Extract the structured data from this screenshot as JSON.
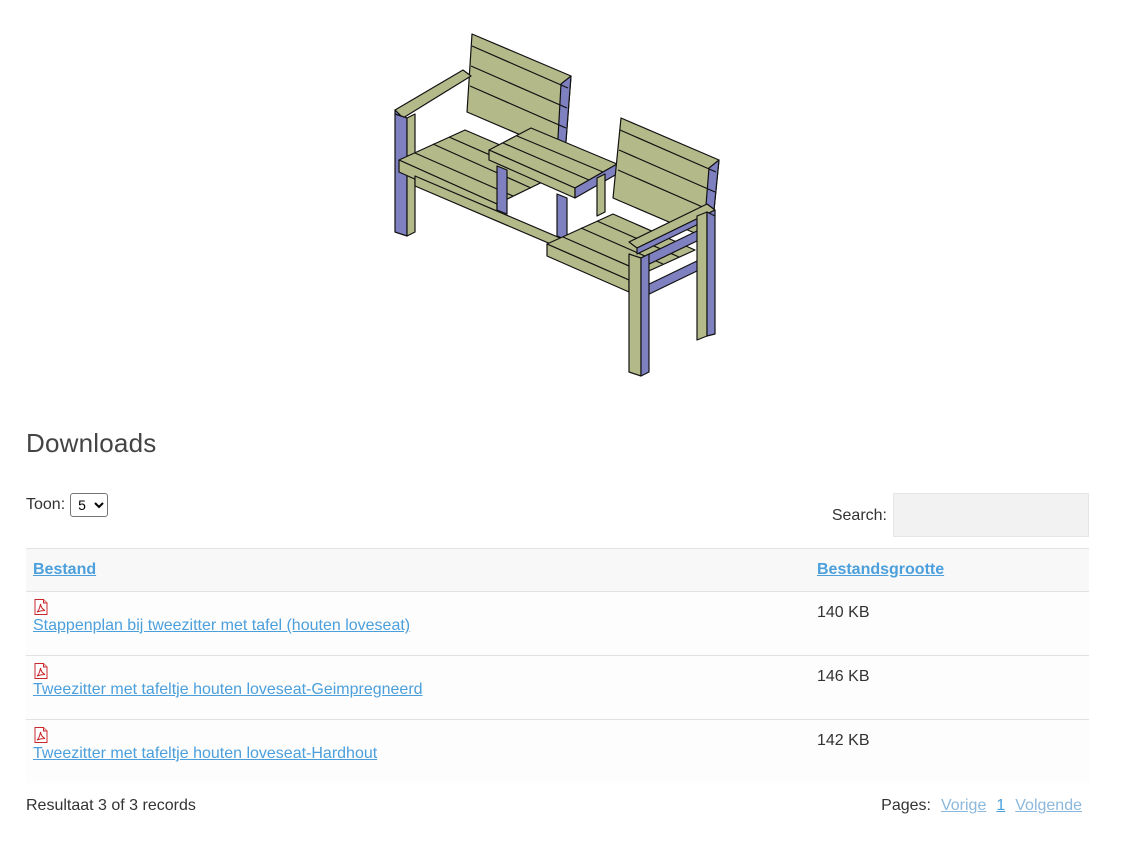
{
  "illustration": {
    "icon": "loveseat-bench-with-table-illustration"
  },
  "section": {
    "title": "Downloads"
  },
  "controls": {
    "show_label": "Toon:",
    "show_value": "5",
    "show_options": [
      "5"
    ],
    "search_label": "Search:",
    "search_value": ""
  },
  "table": {
    "headers": {
      "file": "Bestand",
      "size": "Bestandsgrootte"
    },
    "rows": [
      {
        "icon": "pdf-icon",
        "name": "Stappenplan bij tweezitter met tafel (houten loveseat)",
        "size": "140 KB"
      },
      {
        "icon": "pdf-icon",
        "name": "Tweezitter met tafeltje houten loveseat-Geimpregneerd",
        "size": "146 KB"
      },
      {
        "icon": "pdf-icon",
        "name": "Tweezitter met tafeltje houten loveseat-Hardhout",
        "size": "142 KB"
      }
    ]
  },
  "footer": {
    "result_text": "Resultaat 3 of 3 records",
    "pages_label": "Pages:",
    "prev_label": "Vorige",
    "current_page": "1",
    "next_label": "Volgende"
  },
  "colors": {
    "link": "#4b9fdc",
    "wood_light": "#b7bb8c",
    "wood_shadow": "#7a7cb8"
  }
}
